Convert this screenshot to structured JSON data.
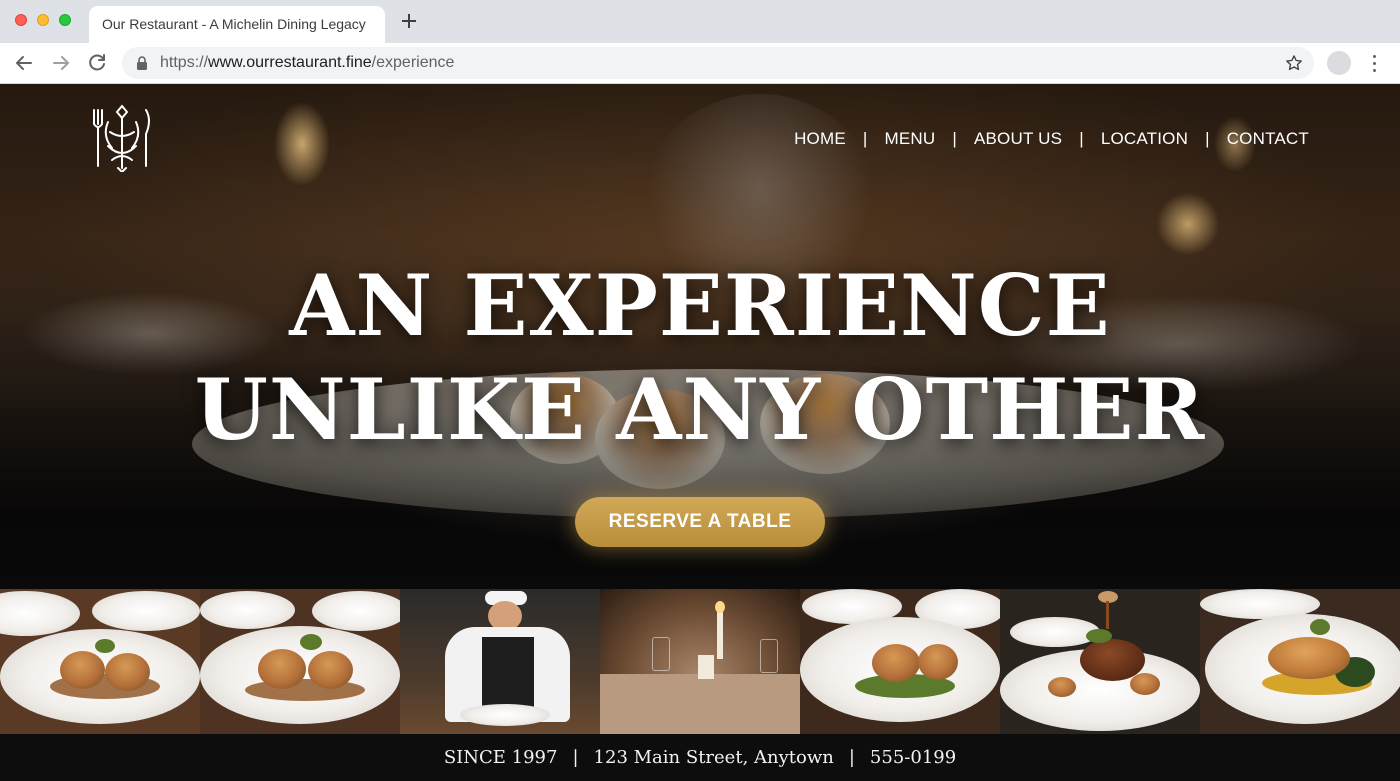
{
  "browser": {
    "tab_title": "Our Restaurant - A Michelin Dining Legacy",
    "url_scheme": "https://",
    "url_host": "www.ourrestaurant.fine",
    "url_path": "/experience"
  },
  "nav": {
    "items": [
      "HOME",
      "MENU",
      "ABOUT US",
      "LOCATION",
      "CONTACT"
    ],
    "separator": "|"
  },
  "hero": {
    "headline_line1": "AN EXPERIENCE",
    "headline_line2": "UNLIKE ANY OTHER",
    "cta_label": "RESERVE A TABLE"
  },
  "gallery": {
    "items": [
      "scallops-plate",
      "scallops-plate",
      "chef-plating",
      "candlelit-table",
      "scallops-plate",
      "steak-sauce-pour",
      "fish-plate"
    ]
  },
  "footer": {
    "since": "SINCE 1997",
    "address": "123 Main Street, Anytown",
    "phone": "555-0199",
    "separator": "|"
  },
  "colors": {
    "accent_gold": "#c89d4a",
    "page_background": "#0d0d0d",
    "nav_text": "#ffffff"
  },
  "icons": [
    "back-arrow-icon",
    "forward-arrow-icon",
    "reload-icon",
    "lock-icon",
    "star-icon",
    "profile-icon",
    "menu-kebab-icon",
    "restaurant-logo-icon",
    "new-tab-icon"
  ]
}
